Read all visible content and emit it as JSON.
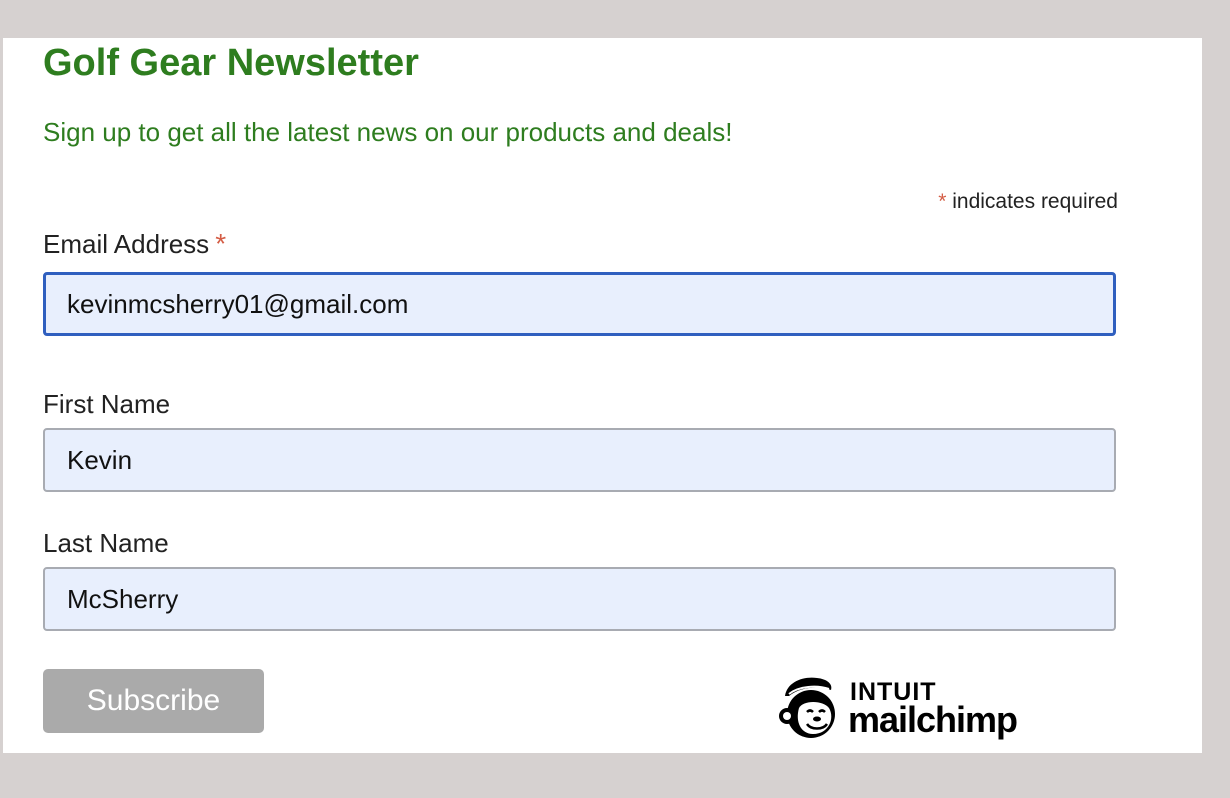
{
  "form": {
    "title": "Golf Gear Newsletter",
    "subtitle": "Sign up to get all the latest news on our products and deals!",
    "required_marker": "*",
    "required_note": " indicates required",
    "email": {
      "label": "Email Address",
      "value": "kevinmcsherry01@gmail.com"
    },
    "first_name": {
      "label": "First Name",
      "value": "Kevin"
    },
    "last_name": {
      "label": "Last Name",
      "value": "McSherry"
    },
    "subscribe_label": "Subscribe"
  },
  "brand": {
    "top": "INTUIT",
    "bottom": "mailchimp",
    "logo_icon": "mailchimp-freddie-icon"
  },
  "colors": {
    "heading_green": "#2e7d1f",
    "required_red": "#d45d45",
    "focus_blue": "#2f5fbf",
    "input_fill": "#e8effd",
    "button_gray": "#aaaaaa"
  }
}
